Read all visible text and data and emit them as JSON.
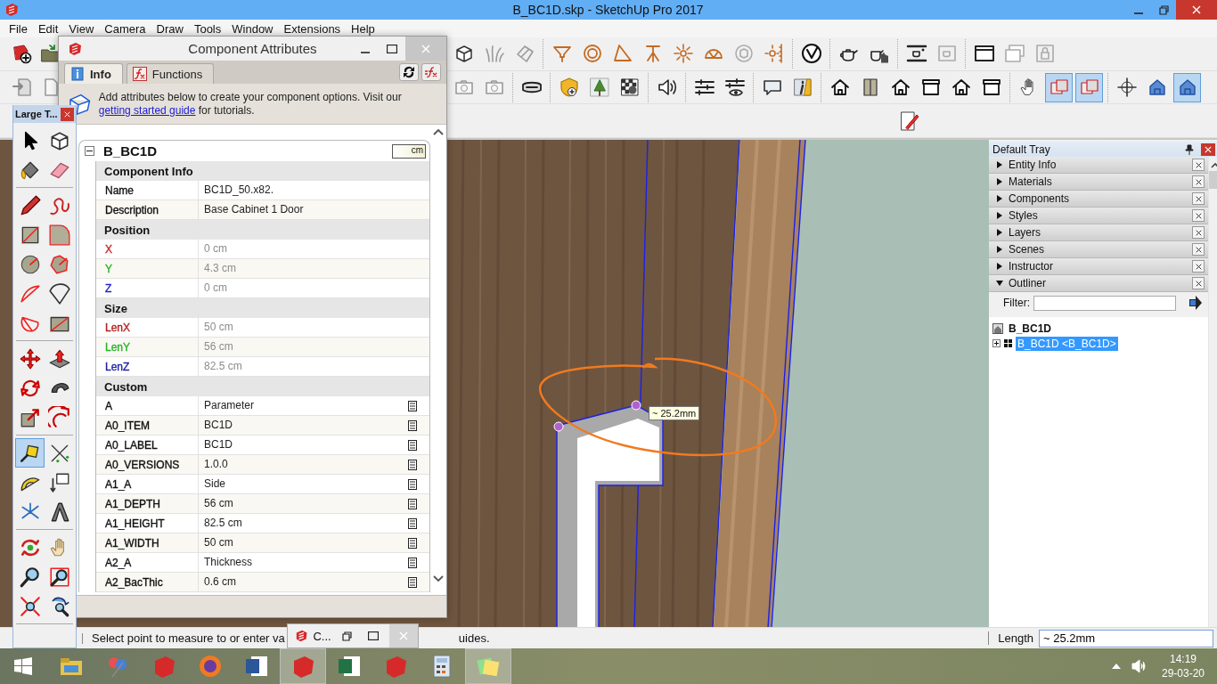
{
  "window": {
    "title": "B_BC1D.skp - SketchUp Pro 2017"
  },
  "menu": [
    "File",
    "Edit",
    "View",
    "Camera",
    "Draw",
    "Tools",
    "Window",
    "Extensions",
    "Help"
  ],
  "toolbar_rows": [
    {
      "left": [
        {
          "selected": false
        },
        {
          "selected": false
        }
      ],
      "groups": [
        [
          {
            "selected": false
          },
          {
            "selected": false
          },
          {
            "selected": false
          }
        ],
        [
          {
            "selected": false
          },
          {
            "selected": false
          },
          {
            "selected": false
          },
          {
            "selected": false
          },
          {
            "selected": false
          },
          {
            "selected": false
          },
          {
            "selected": false
          },
          {
            "selected": false
          }
        ],
        [
          {
            "selected": false
          }
        ],
        [
          {
            "selected": false
          },
          {
            "selected": false
          }
        ],
        [
          {
            "selected": false
          },
          {
            "selected": false
          }
        ],
        [
          {
            "selected": false
          },
          {
            "selected": false
          },
          {
            "selected": false
          }
        ]
      ]
    },
    {
      "left": [
        {
          "selected": false
        },
        {
          "selected": false
        }
      ],
      "groups": [
        [
          {
            "selected": false
          },
          {
            "selected": false
          }
        ],
        [
          {
            "selected": false
          }
        ],
        [
          {
            "selected": false
          },
          {
            "selected": false
          },
          {
            "selected": false
          }
        ],
        [
          {
            "selected": false
          }
        ],
        [
          {
            "selected": false
          },
          {
            "selected": false
          }
        ],
        [
          {
            "selected": false
          },
          {
            "selected": false
          }
        ],
        [
          {
            "selected": false
          },
          {
            "selected": false
          },
          {
            "selected": false
          },
          {
            "selected": false
          },
          {
            "selected": false
          },
          {
            "selected": false
          }
        ],
        [
          {
            "selected": false
          },
          {
            "selected": true
          },
          {
            "selected": true
          }
        ],
        [
          {
            "selected": false
          },
          {
            "selected": false
          },
          {
            "selected": true
          }
        ]
      ]
    },
    {
      "left": [],
      "groups": [
        [
          {
            "selected": false
          }
        ]
      ]
    }
  ],
  "viewport": {
    "measure_tooltip": "~ 25.2mm"
  },
  "tray": {
    "title": "Default Tray",
    "panels": [
      {
        "label": "Entity Info",
        "expanded": false
      },
      {
        "label": "Materials",
        "expanded": false
      },
      {
        "label": "Components",
        "expanded": false
      },
      {
        "label": "Styles",
        "expanded": false
      },
      {
        "label": "Layers",
        "expanded": false
      },
      {
        "label": "Scenes",
        "expanded": false
      },
      {
        "label": "Instructor",
        "expanded": false
      },
      {
        "label": "Outliner",
        "expanded": true
      }
    ],
    "outliner": {
      "filter_label": "Filter:",
      "tree": [
        {
          "label": "B_BC1D",
          "selected": false,
          "children": [
            {
              "label": "B_BC1D <B_BC1D>",
              "selected": true,
              "expanded": false
            }
          ]
        }
      ]
    }
  },
  "status_bar": {
    "hint": "Select point to measure to or enter va",
    "hint_tail": "uides.",
    "length_label": "Length",
    "length_value": "~ 25.2mm"
  },
  "taskbar": {
    "apps": [
      {
        "selected": false
      },
      {
        "selected": false
      },
      {
        "selected": false
      },
      {
        "selected": false
      },
      {
        "selected": false
      },
      {
        "selected": true
      },
      {
        "selected": false
      },
      {
        "selected": false
      },
      {
        "selected": false
      },
      {
        "selected": true
      }
    ],
    "time": "14:19",
    "date": "29-03-20"
  },
  "minimized_window": {
    "title": "C..."
  },
  "tool_set": {
    "title": "Large T...",
    "groups": [
      [
        {
          "selected": false
        },
        {
          "selected": false
        },
        {
          "selected": false
        },
        {
          "selected": false
        }
      ],
      [
        {
          "selected": false
        },
        {
          "selected": false
        },
        {
          "selected": false
        },
        {
          "selected": false
        },
        {
          "selected": false
        },
        {
          "selected": false
        },
        {
          "selected": false
        },
        {
          "selected": false
        },
        {
          "selected": false
        },
        {
          "selected": false
        }
      ],
      [
        {
          "selected": false
        },
        {
          "selected": false
        },
        {
          "selected": false
        },
        {
          "selected": false
        },
        {
          "selected": false
        },
        {
          "selected": false
        }
      ],
      [
        {
          "selected": true
        },
        {
          "selected": false
        },
        {
          "selected": false
        },
        {
          "selected": false
        },
        {
          "selected": false
        },
        {
          "selected": false
        }
      ],
      [
        {
          "selected": false
        },
        {
          "selected": false
        },
        {
          "selected": false
        },
        {
          "selected": false
        },
        {
          "selected": false
        },
        {
          "selected": false
        }
      ]
    ]
  },
  "dialog": {
    "title": "Component Attributes",
    "tabs": [
      {
        "label": "Info",
        "selected": true
      },
      {
        "label": "Functions",
        "selected": false
      }
    ],
    "banner": "Add attributes below to create your component options. Visit our ",
    "banner_link": "getting started guide",
    "banner_tail": " for tutorials.",
    "component": {
      "name": "B_BC1D",
      "units": "cm",
      "expanded": true,
      "rows": [
        {
          "kind": "section",
          "name": "Component Info"
        },
        {
          "kind": "field",
          "name": "Name",
          "value": "BC1D_50.x82."
        },
        {
          "kind": "field",
          "name": "Description",
          "value": "Base Cabinet 1 Door"
        },
        {
          "kind": "section",
          "name": "Position"
        },
        {
          "kind": "readonly",
          "name": "X",
          "value": "0 cm",
          "color": "#cc1f1f"
        },
        {
          "kind": "readonly",
          "name": "Y",
          "value": "4.3 cm",
          "color": "#27b327"
        },
        {
          "kind": "readonly",
          "name": "Z",
          "value": "0 cm",
          "color": "#2323c8"
        },
        {
          "kind": "section",
          "name": "Size"
        },
        {
          "kind": "readonly",
          "name": "LenX",
          "value": "50 cm",
          "color": "#b31f1f"
        },
        {
          "kind": "readonly",
          "name": "LenY",
          "value": "56 cm",
          "color": "#27b327"
        },
        {
          "kind": "readonly",
          "name": "LenZ",
          "value": "82.5 cm",
          "color": "#2323a8"
        },
        {
          "kind": "section",
          "name": "Custom"
        },
        {
          "kind": "attribute",
          "name": "A",
          "value": "Parameter"
        },
        {
          "kind": "attribute",
          "name": "A0_ITEM",
          "value": "BC1D"
        },
        {
          "kind": "attribute",
          "name": "A0_LABEL",
          "value": "BC1D"
        },
        {
          "kind": "attribute",
          "name": "A0_VERSIONS",
          "value": "1.0.0"
        },
        {
          "kind": "attribute",
          "name": "A1_A",
          "value": "Side"
        },
        {
          "kind": "attribute",
          "name": "A1_DEPTH",
          "value": "56 cm"
        },
        {
          "kind": "attribute",
          "name": "A1_HEIGHT",
          "value": "82.5 cm"
        },
        {
          "kind": "attribute",
          "name": "A1_WIDTH",
          "value": "50 cm"
        },
        {
          "kind": "attribute",
          "name": "A2_A",
          "value": "Thickness"
        },
        {
          "kind": "attribute",
          "name": "A2_BacThic",
          "value": "0.6 cm"
        }
      ]
    }
  }
}
